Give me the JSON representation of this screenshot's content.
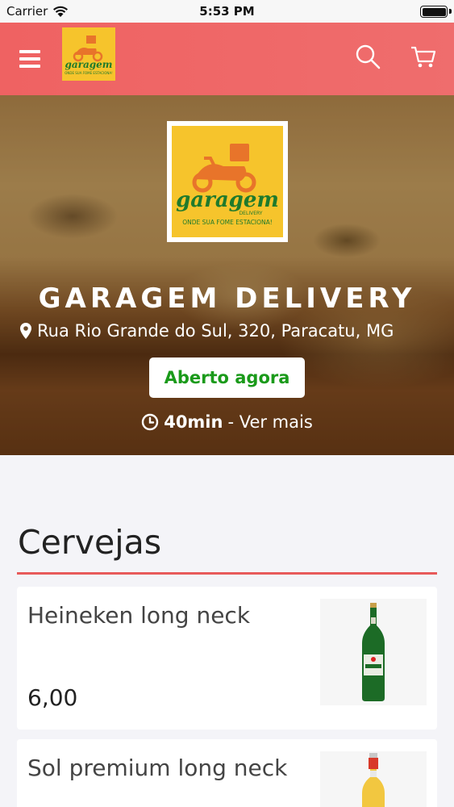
{
  "status_bar": {
    "carrier": "Carrier",
    "time": "5:53 PM"
  },
  "header": {
    "menu_icon": "hamburger-icon",
    "search_icon": "search-icon",
    "cart_icon": "cart-icon",
    "brand_color": "#ef6666"
  },
  "logo": {
    "brand": "garagem",
    "sub": "DELIVERY",
    "tagline": "ONDE SUA FOME ESTACIONA!"
  },
  "store": {
    "name": "GARAGEM DELIVERY",
    "address": "Rua Rio Grande do Sul, 320, Paracatu, MG",
    "status": "Aberto agora",
    "delivery_time": "40min",
    "see_more": "- Ver mais"
  },
  "section": {
    "title": "Cervejas"
  },
  "products": [
    {
      "name": "Heineken long neck",
      "price": "6,00"
    },
    {
      "name": "Sol premium long neck",
      "price": ""
    }
  ],
  "colors": {
    "accent": "#e85a5a",
    "open_green": "#1a9a1a",
    "logo_yellow": "#f6c42c"
  }
}
